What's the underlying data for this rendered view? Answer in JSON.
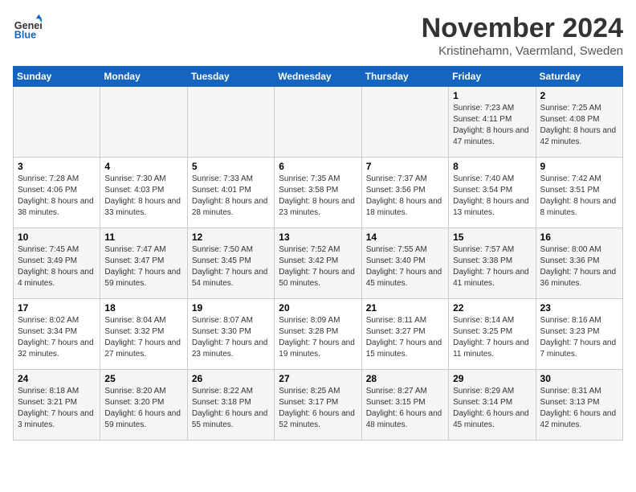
{
  "logo": {
    "line1": "General",
    "line2": "Blue"
  },
  "title": "November 2024",
  "subtitle": "Kristinehamn, Vaermland, Sweden",
  "days_of_week": [
    "Sunday",
    "Monday",
    "Tuesday",
    "Wednesday",
    "Thursday",
    "Friday",
    "Saturday"
  ],
  "weeks": [
    [
      {
        "day": "",
        "info": ""
      },
      {
        "day": "",
        "info": ""
      },
      {
        "day": "",
        "info": ""
      },
      {
        "day": "",
        "info": ""
      },
      {
        "day": "",
        "info": ""
      },
      {
        "day": "1",
        "info": "Sunrise: 7:23 AM\nSunset: 4:11 PM\nDaylight: 8 hours and 47 minutes."
      },
      {
        "day": "2",
        "info": "Sunrise: 7:25 AM\nSunset: 4:08 PM\nDaylight: 8 hours and 42 minutes."
      }
    ],
    [
      {
        "day": "3",
        "info": "Sunrise: 7:28 AM\nSunset: 4:06 PM\nDaylight: 8 hours and 38 minutes."
      },
      {
        "day": "4",
        "info": "Sunrise: 7:30 AM\nSunset: 4:03 PM\nDaylight: 8 hours and 33 minutes."
      },
      {
        "day": "5",
        "info": "Sunrise: 7:33 AM\nSunset: 4:01 PM\nDaylight: 8 hours and 28 minutes."
      },
      {
        "day": "6",
        "info": "Sunrise: 7:35 AM\nSunset: 3:58 PM\nDaylight: 8 hours and 23 minutes."
      },
      {
        "day": "7",
        "info": "Sunrise: 7:37 AM\nSunset: 3:56 PM\nDaylight: 8 hours and 18 minutes."
      },
      {
        "day": "8",
        "info": "Sunrise: 7:40 AM\nSunset: 3:54 PM\nDaylight: 8 hours and 13 minutes."
      },
      {
        "day": "9",
        "info": "Sunrise: 7:42 AM\nSunset: 3:51 PM\nDaylight: 8 hours and 8 minutes."
      }
    ],
    [
      {
        "day": "10",
        "info": "Sunrise: 7:45 AM\nSunset: 3:49 PM\nDaylight: 8 hours and 4 minutes."
      },
      {
        "day": "11",
        "info": "Sunrise: 7:47 AM\nSunset: 3:47 PM\nDaylight: 7 hours and 59 minutes."
      },
      {
        "day": "12",
        "info": "Sunrise: 7:50 AM\nSunset: 3:45 PM\nDaylight: 7 hours and 54 minutes."
      },
      {
        "day": "13",
        "info": "Sunrise: 7:52 AM\nSunset: 3:42 PM\nDaylight: 7 hours and 50 minutes."
      },
      {
        "day": "14",
        "info": "Sunrise: 7:55 AM\nSunset: 3:40 PM\nDaylight: 7 hours and 45 minutes."
      },
      {
        "day": "15",
        "info": "Sunrise: 7:57 AM\nSunset: 3:38 PM\nDaylight: 7 hours and 41 minutes."
      },
      {
        "day": "16",
        "info": "Sunrise: 8:00 AM\nSunset: 3:36 PM\nDaylight: 7 hours and 36 minutes."
      }
    ],
    [
      {
        "day": "17",
        "info": "Sunrise: 8:02 AM\nSunset: 3:34 PM\nDaylight: 7 hours and 32 minutes."
      },
      {
        "day": "18",
        "info": "Sunrise: 8:04 AM\nSunset: 3:32 PM\nDaylight: 7 hours and 27 minutes."
      },
      {
        "day": "19",
        "info": "Sunrise: 8:07 AM\nSunset: 3:30 PM\nDaylight: 7 hours and 23 minutes."
      },
      {
        "day": "20",
        "info": "Sunrise: 8:09 AM\nSunset: 3:28 PM\nDaylight: 7 hours and 19 minutes."
      },
      {
        "day": "21",
        "info": "Sunrise: 8:11 AM\nSunset: 3:27 PM\nDaylight: 7 hours and 15 minutes."
      },
      {
        "day": "22",
        "info": "Sunrise: 8:14 AM\nSunset: 3:25 PM\nDaylight: 7 hours and 11 minutes."
      },
      {
        "day": "23",
        "info": "Sunrise: 8:16 AM\nSunset: 3:23 PM\nDaylight: 7 hours and 7 minutes."
      }
    ],
    [
      {
        "day": "24",
        "info": "Sunrise: 8:18 AM\nSunset: 3:21 PM\nDaylight: 7 hours and 3 minutes."
      },
      {
        "day": "25",
        "info": "Sunrise: 8:20 AM\nSunset: 3:20 PM\nDaylight: 6 hours and 59 minutes."
      },
      {
        "day": "26",
        "info": "Sunrise: 8:22 AM\nSunset: 3:18 PM\nDaylight: 6 hours and 55 minutes."
      },
      {
        "day": "27",
        "info": "Sunrise: 8:25 AM\nSunset: 3:17 PM\nDaylight: 6 hours and 52 minutes."
      },
      {
        "day": "28",
        "info": "Sunrise: 8:27 AM\nSunset: 3:15 PM\nDaylight: 6 hours and 48 minutes."
      },
      {
        "day": "29",
        "info": "Sunrise: 8:29 AM\nSunset: 3:14 PM\nDaylight: 6 hours and 45 minutes."
      },
      {
        "day": "30",
        "info": "Sunrise: 8:31 AM\nSunset: 3:13 PM\nDaylight: 6 hours and 42 minutes."
      }
    ]
  ]
}
